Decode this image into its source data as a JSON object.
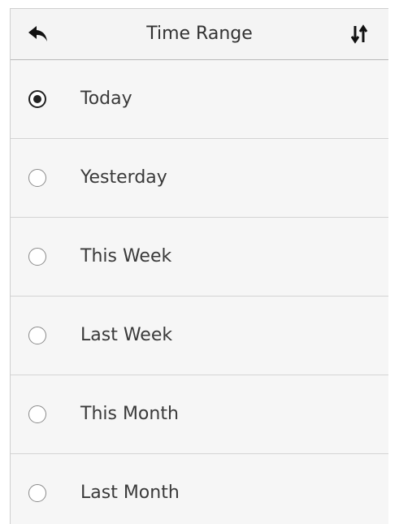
{
  "header": {
    "title": "Time Range",
    "back_icon": "back-arrow-icon",
    "sort_icon": "sort-arrows-icon"
  },
  "options": [
    {
      "label": "Today",
      "selected": true
    },
    {
      "label": "Yesterday",
      "selected": false
    },
    {
      "label": "This Week",
      "selected": false
    },
    {
      "label": "Last Week",
      "selected": false
    },
    {
      "label": "This Month",
      "selected": false
    },
    {
      "label": "Last Month",
      "selected": false
    }
  ],
  "colors": {
    "background": "#f6f6f6",
    "divider": "#d4d4d4",
    "text": "#333333",
    "radio_selected": "#222222",
    "radio_border": "#8a8a8a"
  }
}
